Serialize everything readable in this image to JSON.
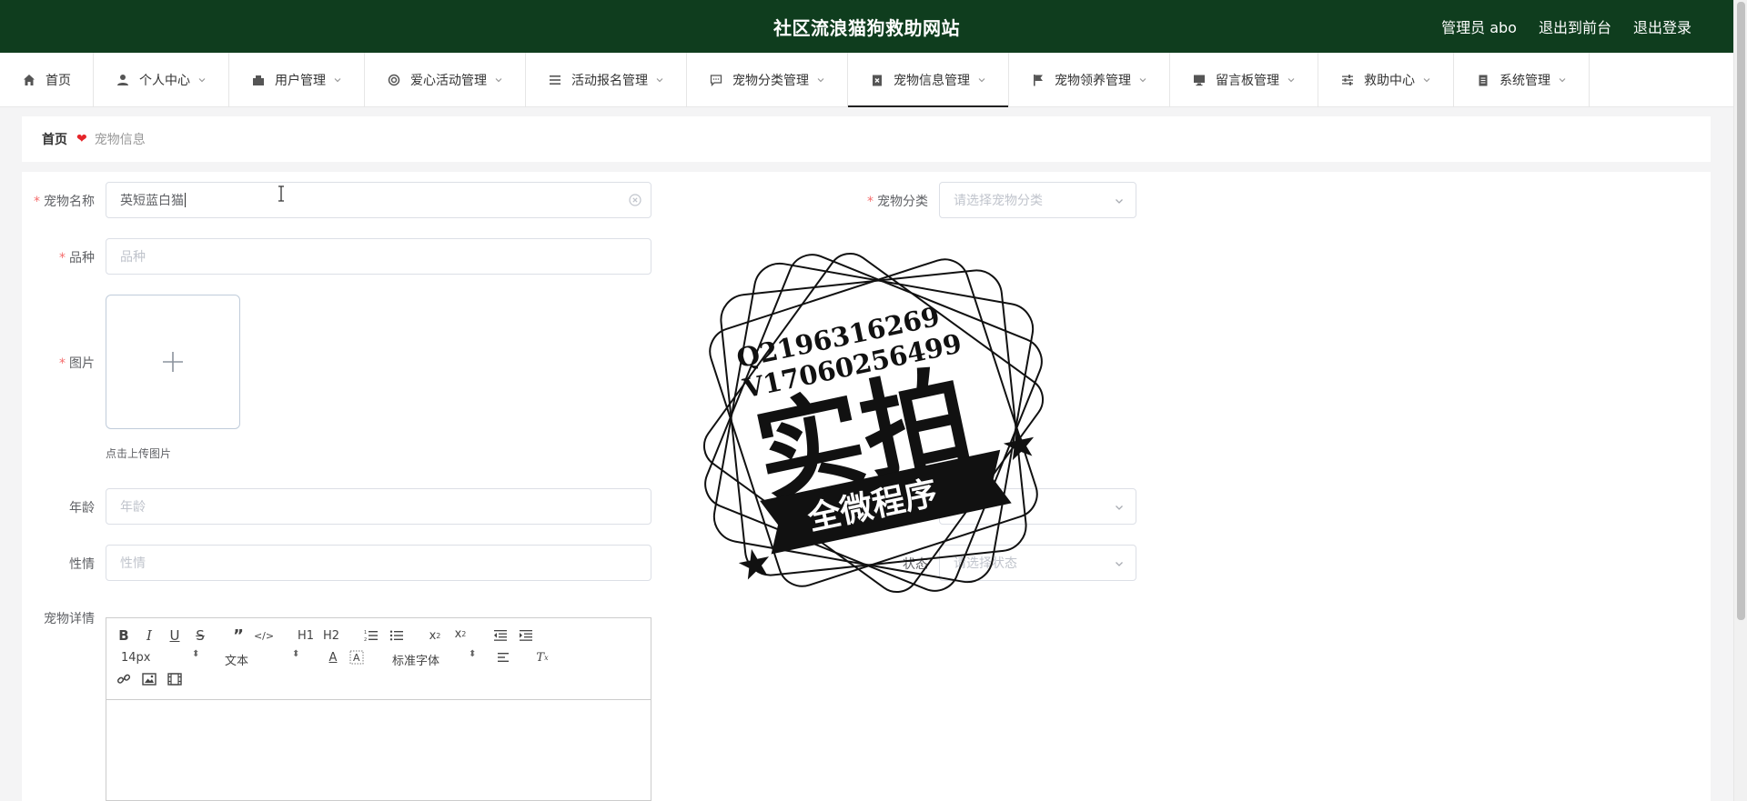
{
  "header": {
    "title": "社区流浪猫狗救助网站",
    "admin": "管理员 abo",
    "to_front": "退出到前台",
    "logout": "退出登录"
  },
  "nav": {
    "items": [
      {
        "label": "首页",
        "icon": "home-icon"
      },
      {
        "label": "个人中心",
        "icon": "user-icon"
      },
      {
        "label": "用户管理",
        "icon": "users-icon"
      },
      {
        "label": "爱心活动管理",
        "icon": "lifebuoy-icon"
      },
      {
        "label": "活动报名管理",
        "icon": "list-icon"
      },
      {
        "label": "宠物分类管理",
        "icon": "chat-icon"
      },
      {
        "label": "宠物信息管理",
        "icon": "clipboard-x-icon"
      },
      {
        "label": "宠物领养管理",
        "icon": "flag-icon"
      },
      {
        "label": "留言板管理",
        "icon": "monitor-icon"
      },
      {
        "label": "救助中心",
        "icon": "sliders-icon"
      },
      {
        "label": "系统管理",
        "icon": "clipboard-icon"
      }
    ],
    "active_index": 6
  },
  "breadcrumb": {
    "home": "首页",
    "current": "宠物信息"
  },
  "form": {
    "name_label": "宠物名称",
    "name_value": "英短蓝白猫",
    "category_label": "宠物分类",
    "category_placeholder": "请选择宠物分类",
    "breed_label": "品种",
    "breed_placeholder": "品种",
    "image_label": "图片",
    "upload_tip": "点击上传图片",
    "age_label": "年龄",
    "age_placeholder": "年龄",
    "temper_label": "性情",
    "temper_placeholder": "性情",
    "status_label": "状态",
    "status_placeholder": "请选择状态",
    "detail_label": "宠物详情"
  },
  "editor": {
    "font_size": "14px",
    "text_type": "文本",
    "font_family": "标准字体",
    "h1": "H1",
    "h2": "H2"
  },
  "stamp": {
    "line1": "Q2196316269",
    "line2": "V17060256499",
    "main": "实拍",
    "ribbon": "全微程序"
  }
}
